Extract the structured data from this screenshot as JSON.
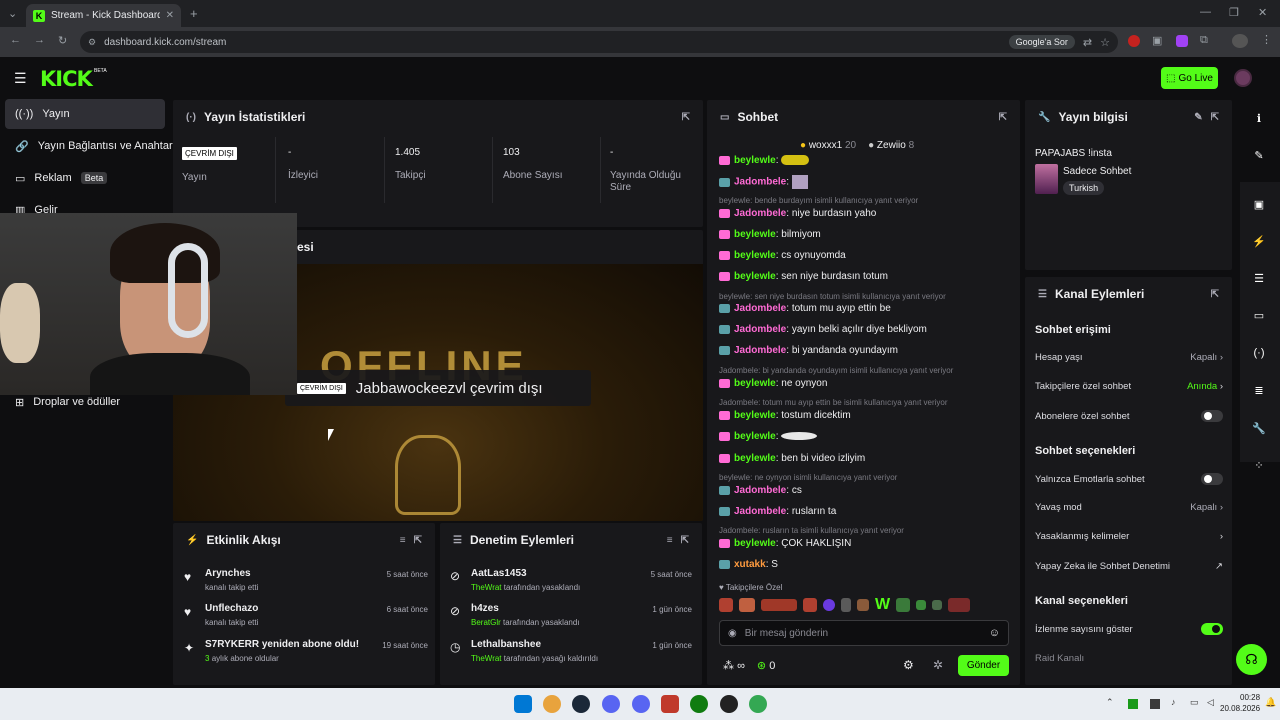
{
  "browser": {
    "tab_title": "Stream - Kick Dashboard",
    "url": "dashboard.kick.com/stream",
    "google_sor": "Google'a Sor"
  },
  "header": {
    "logo": "KICK",
    "logo_beta": "BETA",
    "go_live": "Go Live"
  },
  "nav": {
    "items": [
      {
        "label": "Yayın"
      },
      {
        "label": "Yayın Bağlantısı ve Anahtarı"
      },
      {
        "label": "Reklam",
        "badge": "Beta"
      },
      {
        "label": "Gelir"
      },
      {
        "label": "Droplar ve ödüller"
      }
    ]
  },
  "stats": {
    "title": "Yayın İstatistikleri",
    "offline_badge": "ÇEVRİM DIŞI",
    "cells": [
      {
        "value": "",
        "label": "Yayın"
      },
      {
        "value": "-",
        "label": "İzleyici"
      },
      {
        "value": "1.405",
        "label": "Takipçi"
      },
      {
        "value": "103",
        "label": "Abone Sayısı"
      },
      {
        "value": "-",
        "label": "Yayında Olduğu Süre"
      }
    ]
  },
  "preview": {
    "title_suffix": "esi",
    "offline_badge": "ÇEVRİM DIŞI",
    "offline_text": "Jabbawockeezvl çevrim dışı",
    "bg_text": "OFFLINE"
  },
  "activity": {
    "title": "Etkinlik Akışı",
    "items": [
      {
        "name": "Arynches",
        "sub": "kanalı takip etti",
        "time": "5 saat önce"
      },
      {
        "name": "Unflechazo",
        "sub": "kanalı takip etti",
        "time": "6 saat önce"
      },
      {
        "name": "S7RYKERR yeniden abone oldu!",
        "sub_highlight": "3",
        "sub": "aylık abone oldular",
        "time": "19 saat önce"
      }
    ]
  },
  "moderation": {
    "title": "Denetim Eylemleri",
    "items": [
      {
        "name": "AatLas1453",
        "mod": "TheWrat",
        "sub": "tarafından yasaklandı",
        "time": "5 saat önce"
      },
      {
        "name": "h4zes",
        "mod": "BeratGlr",
        "sub": "tarafından yasaklandı",
        "time": "1 gün önce"
      },
      {
        "name": "Lethalbanshee",
        "mod": "TheWrat",
        "sub": "tarafından yasağı kaldırıldı",
        "time": "1 gün önce"
      }
    ]
  },
  "chat": {
    "title": "Sohbet",
    "top_users": [
      {
        "name": "woxxx1",
        "count": "20"
      },
      {
        "name": "Zewiio",
        "count": "8"
      }
    ],
    "messages": [
      {
        "user": "beylewle",
        "text": "",
        "color": "green"
      },
      {
        "user": "Jadombele",
        "text": "",
        "color": "pink"
      },
      {
        "reply": "beylewle: bende burdayım isimli kullanıcıya yanıt veriyor"
      },
      {
        "user": "Jadombele",
        "text": "niye burdasın yaho",
        "color": "pink"
      },
      {
        "user": "beylewle",
        "text": "bilmiyom",
        "color": "green"
      },
      {
        "user": "beylewle",
        "text": "cs oynuyomda",
        "color": "green"
      },
      {
        "user": "beylewle",
        "text": "sen niye burdasın totum",
        "color": "green"
      },
      {
        "reply": "beylewle: sen niye burdasın totum isimli kullanıcıya yanıt veriyor"
      },
      {
        "user": "Jadombele",
        "text": "totum mu ayıp ettin be",
        "color": "pink"
      },
      {
        "user": "Jadombele",
        "text": "yayın belki açılır diye bekliyom",
        "color": "pink"
      },
      {
        "user": "Jadombele",
        "text": "bi yandanda oyundayım",
        "color": "pink"
      },
      {
        "reply": "Jadombele: bi yandanda oyundayım isimli kullanıcıya yanıt veriyor"
      },
      {
        "user": "beylewle",
        "text": "ne oynyon",
        "color": "green"
      },
      {
        "reply": "Jadombele: totum mu ayıp ettin be isimli kullanıcıya yanıt veriyor"
      },
      {
        "user": "beylewle",
        "text": "tostum dicektim",
        "color": "green"
      },
      {
        "user": "beylewle",
        "text": "",
        "color": "green"
      },
      {
        "user": "beylewle",
        "text": "ben bi video izliyim",
        "color": "green"
      },
      {
        "reply": "beylewle: ne oynyon isimli kullanıcıya yanıt veriyor"
      },
      {
        "user": "Jadombele",
        "text": "cs",
        "color": "pink"
      },
      {
        "user": "Jadombele",
        "text": "rusların ta",
        "color": "pink"
      },
      {
        "reply": "Jadombele: rusların ta isimli kullanıcıya yanıt veriyor"
      },
      {
        "user": "beylewle",
        "text": "ÇOK HAKLIŞIN",
        "color": "green"
      },
      {
        "user": "xutakk",
        "text": "S",
        "color": "orange"
      }
    ],
    "followers_only": "Takipçilere Özel",
    "input_placeholder": "Bir mesaj gönderin",
    "infinity_label": "∞",
    "points": "0",
    "send": "Gönder"
  },
  "stream_info": {
    "title": "Yayın bilgisi",
    "stream_title": "PAPAJABS !insta",
    "category": "Sadece Sohbet",
    "tag": "Turkish"
  },
  "channel_actions": {
    "title": "Kanal Eylemleri",
    "sections": [
      {
        "title": "Sohbet erişimi",
        "rows": [
          {
            "label": "Hesap yaşı",
            "value": "Kapalı",
            "type": "chevron"
          },
          {
            "label": "Takipçilere özel sohbet",
            "value": "Anında",
            "type": "chevron",
            "value_color": "#53fc18"
          },
          {
            "label": "Abonelere özel sohbet",
            "type": "toggle",
            "on": false
          }
        ]
      },
      {
        "title": "Sohbet seçenekleri",
        "rows": [
          {
            "label": "Yalnızca Emotlarla sohbet",
            "type": "toggle",
            "on": false
          },
          {
            "label": "Yavaş mod",
            "value": "Kapalı",
            "type": "chevron"
          },
          {
            "label": "Yasaklanmış kelimeler",
            "type": "chevron"
          },
          {
            "label": "Yapay Zeka ile Sohbet Denetimi",
            "type": "external"
          }
        ]
      },
      {
        "title": "Kanal seçenekleri",
        "rows": [
          {
            "label": "İzlenme sayısını göster",
            "type": "toggle",
            "on": true
          },
          {
            "label": "Raid Kanalı",
            "type": "dim"
          }
        ]
      }
    ]
  },
  "taskbar": {
    "time": "00:28",
    "date": "20.08.2026"
  },
  "colors": {
    "accent": "#53fc18",
    "bg": "#0e0e10",
    "panel": "#18181b",
    "pink": "#ff6bd5"
  }
}
